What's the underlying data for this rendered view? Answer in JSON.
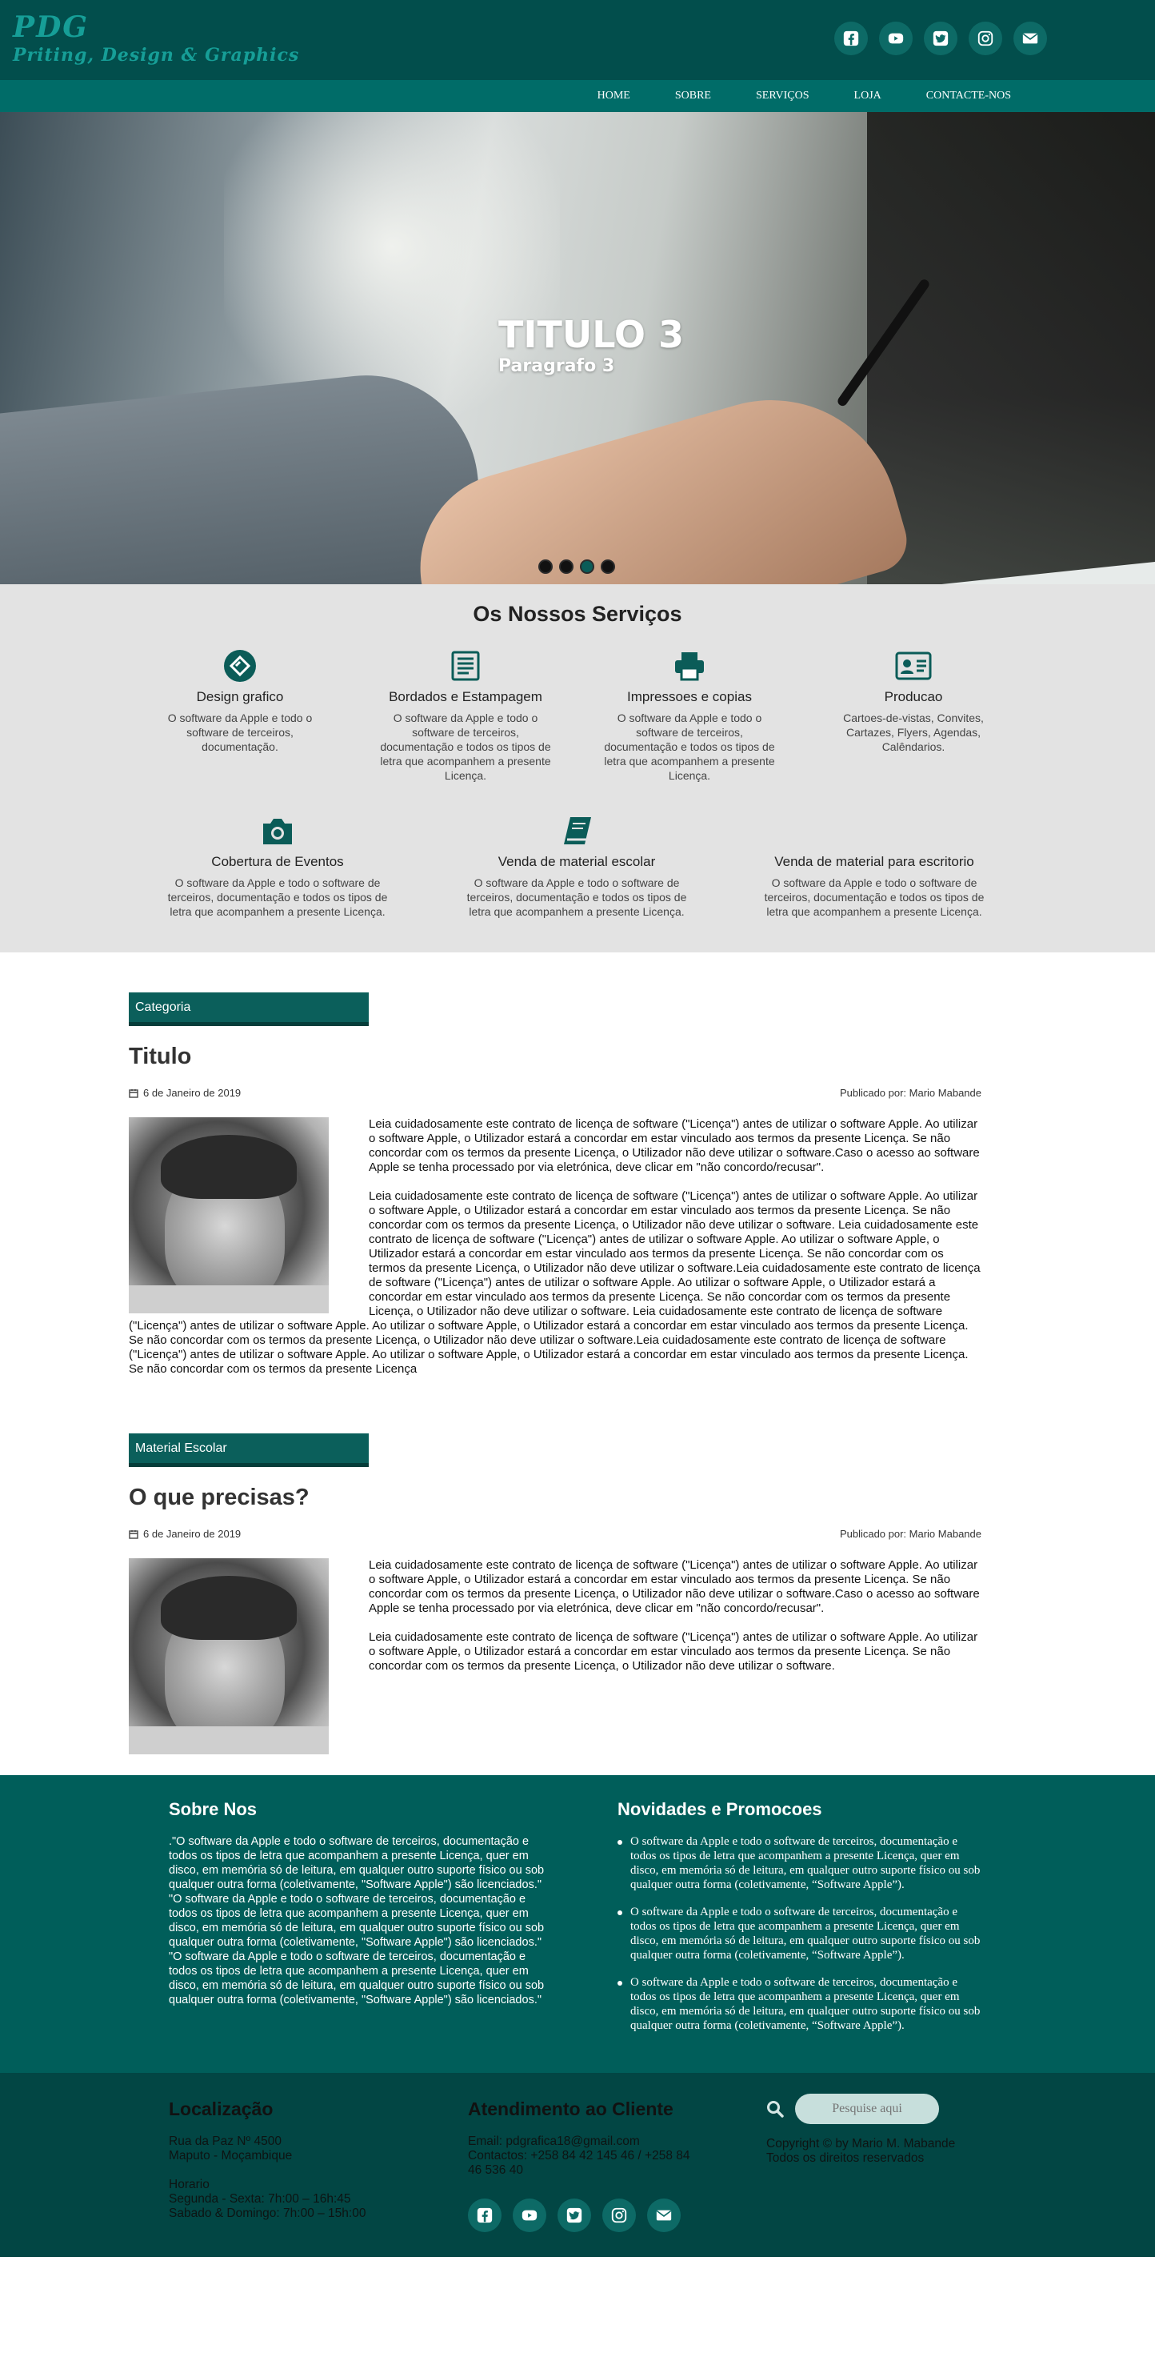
{
  "brand": {
    "name": "PDG",
    "tagline": "Priting, Design & Graphics"
  },
  "social": [
    {
      "icon": "facebook-icon"
    },
    {
      "icon": "youtube-icon"
    },
    {
      "icon": "twitter-icon"
    },
    {
      "icon": "instagram-icon"
    },
    {
      "icon": "envelope-icon"
    }
  ],
  "nav": {
    "items": [
      {
        "label": "HOME"
      },
      {
        "label": "SOBRE"
      },
      {
        "label": "SERVIÇOS"
      },
      {
        "label": "LOJA"
      },
      {
        "label": "CONTACTE-NOS"
      }
    ]
  },
  "hero": {
    "title": "TITULO 3",
    "subtitle": "Paragrafo 3",
    "slides": 4,
    "active_slide": 3
  },
  "services": {
    "title": "Os Nossos Serviços",
    "items": [
      {
        "icon": "design-icon",
        "name": "Design grafico",
        "desc": "O software da Apple e todo o software de terceiros, documentação."
      },
      {
        "icon": "newspaper-icon",
        "name": "Bordados e Estampagem",
        "desc": "O software da Apple e todo o software de terceiros, documentação e todos os tipos de letra que acompanhem a presente Licença."
      },
      {
        "icon": "printer-icon",
        "name": "Impressoes e copias",
        "desc": "O software da Apple e todo o software de terceiros, documentação e todos os tipos de letra que acompanhem a presente Licença."
      },
      {
        "icon": "id-card-icon",
        "name": "Producao",
        "desc": "Cartoes-de-vistas, Convites, Cartazes, Flyers, Agendas, Calêndarios."
      },
      {
        "icon": "camera-icon",
        "name": "Cobertura de Eventos",
        "desc": "O software da Apple e todo o software de terceiros, documentação e todos os tipos de letra que acompanhem a presente Licença."
      },
      {
        "icon": "book-icon",
        "name": "Venda de material escolar",
        "desc": "O software da Apple e todo o software de terceiros, documentação e todos os tipos de letra que acompanhem a presente Licença."
      },
      {
        "icon": "",
        "name": "Venda de material para escritorio",
        "desc": "O software da Apple e todo o software de terceiros, documentação e todos os tipos de letra que acompanhem a presente Licença."
      }
    ]
  },
  "posts": [
    {
      "category": "Categoria",
      "title": "Titulo",
      "date": "6 de Janeiro de 2019",
      "author": "Publicado por: Mario Mabande",
      "paragraphs": [
        "Leia cuidadosamente este contrato de licença de software (\"Licença\") antes de utilizar o software Apple. Ao utilizar o software Apple, o Utilizador estará a concordar em estar vinculado aos termos da presente Licença. Se não concordar com os termos da presente Licença, o Utilizador não deve utilizar o software.Caso o acesso ao software Apple se tenha processado por via eletrónica, deve clicar em \"não concordo/recusar\".",
        "Leia cuidadosamente este contrato de licença de software (\"Licença\") antes de utilizar o software Apple. Ao utilizar o software Apple, o Utilizador estará a concordar em estar vinculado aos termos da presente Licença. Se não concordar com os termos da presente Licença, o Utilizador não deve utilizar o software. Leia cuidadosamente este contrato de licença de software (\"Licença\") antes de utilizar o software Apple. Ao utilizar o software Apple, o Utilizador estará a concordar em estar vinculado aos termos da presente Licença. Se não concordar com os termos da presente Licença, o Utilizador não deve utilizar o software.Leia cuidadosamente este contrato de licença de software (\"Licença\") antes de utilizar o software Apple. Ao utilizar o software Apple, o Utilizador estará a concordar em estar vinculado aos termos da presente Licença. Se não concordar com os termos da presente Licença, o Utilizador não deve utilizar o software. Leia cuidadosamente este contrato de licença de software (\"Licença\") antes de utilizar o software Apple. Ao utilizar o software Apple, o Utilizador estará a concordar em estar vinculado aos termos da presente Licença. Se não concordar com os termos da presente Licença, o Utilizador não deve utilizar o software.Leia cuidadosamente este contrato de licença de software (\"Licença\") antes de utilizar o software Apple. Ao utilizar o software Apple, o Utilizador estará a concordar em estar vinculado aos termos da presente Licença. Se não concordar com os termos da presente Licença"
      ]
    },
    {
      "category": "Material Escolar",
      "title": "O que precisas?",
      "date": "6 de Janeiro de 2019",
      "author": "Publicado por: Mario Mabande",
      "paragraphs": [
        "Leia cuidadosamente este contrato de licença de software (\"Licença\") antes de utilizar o software Apple. Ao utilizar o software Apple, o Utilizador estará a concordar em estar vinculado aos termos da presente Licença. Se não concordar com os termos da presente Licença, o Utilizador não deve utilizar o software.Caso o acesso ao software Apple se tenha processado por via eletrónica, deve clicar em \"não concordo/recusar\".",
        "Leia cuidadosamente este contrato de licença de software (\"Licença\") antes de utilizar o software Apple. Ao utilizar o software Apple, o Utilizador estará a concordar em estar vinculado aos termos da presente Licença. Se não concordar com os termos da presente Licença, o Utilizador não deve utilizar o software."
      ]
    }
  ],
  "about": {
    "heading": "Sobre Nos",
    "lines": [
      ".\"O software da Apple e todo o software de terceiros, documentação e todos os tipos de letra que acompanhem a presente Licença, quer em disco, em memória só de leitura, em qualquer outro suporte físico ou sob qualquer outra forma (coletivamente, \"Software Apple\") são licenciados.\"",
      "\"O software da Apple e todo o software de terceiros, documentação e todos os tipos de letra que acompanhem a presente Licença, quer em disco, em memória só de leitura, em qualquer outro suporte físico ou sob qualquer outra forma (coletivamente, \"Software Apple\") são licenciados.\"",
      "\"O software da Apple e todo o software de terceiros, documentação e todos os tipos de letra que acompanhem a presente Licença, quer em disco, em memória só de leitura, em qualquer outro suporte físico ou sob qualquer outra forma (coletivamente, \"Software Apple\") são licenciados.\""
    ]
  },
  "news": {
    "heading": "Novidades e Promocoes",
    "items": [
      "O software da Apple e todo o software de terceiros, documentação e todos os tipos de letra que acompanhem a presente Licença, quer em disco, em memória só de leitura, em qualquer outro suporte físico ou sob qualquer outra forma (coletivamente, “Software Apple”).",
      "O software da Apple e todo o software de terceiros, documentação e todos os tipos de letra que acompanhem a presente Licença, quer em disco, em memória só de leitura, em qualquer outro suporte físico ou sob qualquer outra forma (coletivamente, “Software Apple”).",
      "O software da Apple e todo o software de terceiros, documentação e todos os tipos de letra que acompanhem a presente Licença, quer em disco, em memória só de leitura, em qualquer outro suporte físico ou sob qualquer outra forma (coletivamente, “Software Apple”)."
    ]
  },
  "location": {
    "heading": "Localização",
    "address_1": "Rua da Paz Nº 4500",
    "address_2": "Maputo - Moçambique",
    "hours_label": "Horario",
    "hours_1": "Segunda - Sexta: 7h:00 – 16h:45",
    "hours_2": "Sabado & Domingo: 7h:00 – 15h:00"
  },
  "support": {
    "heading": "Atendimento ao Cliente",
    "email": "Email: pdgrafica18@gmail.com",
    "contacts": "Contactos: +258 84 42 145 46 / +258 84 46 536 40"
  },
  "search": {
    "placeholder": "Pesquise aqui",
    "copyright": "Copyright © by Mario M. Mabande",
    "rights": "Todos os direitos reservados"
  },
  "colors": {
    "header_bg": "#024e4c",
    "nav_bg": "#006c68",
    "accent": "#169e97",
    "services_bg": "#e3e3e3",
    "footer_top_bg": "#005e5a",
    "footer_bottom_bg": "#024644"
  }
}
